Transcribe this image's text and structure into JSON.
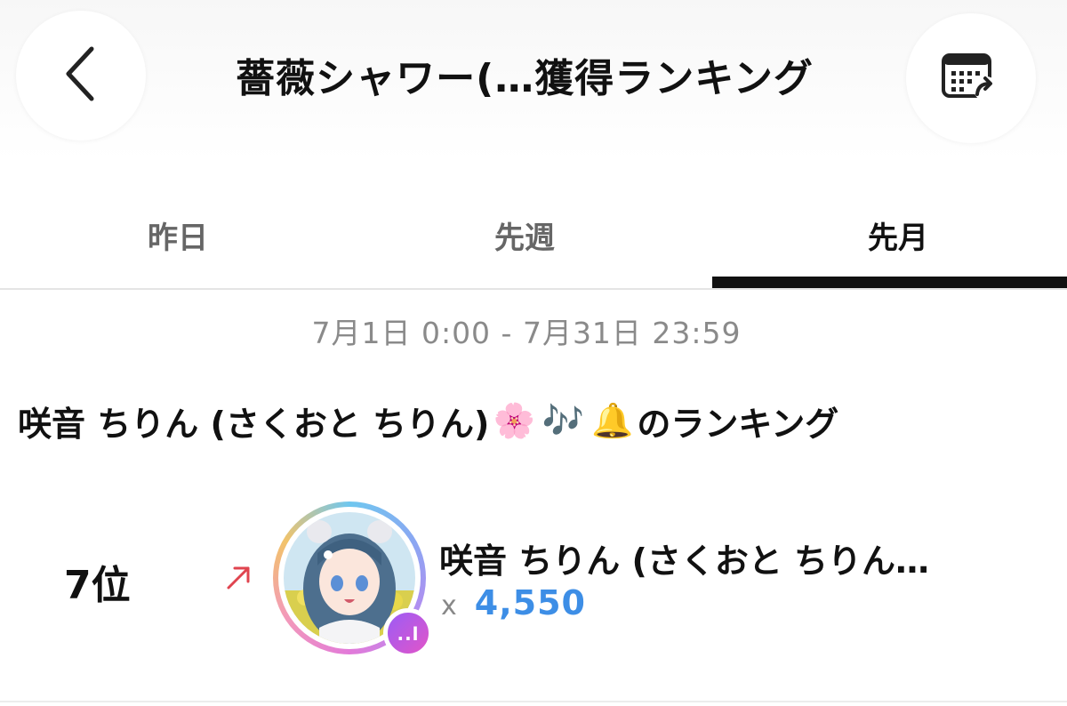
{
  "header": {
    "title": "薔薇シャワー(…獲得ランキング",
    "back_icon": "chevron-left-icon",
    "calendar_icon": "calendar-share-icon"
  },
  "tabs": [
    {
      "label": "昨日",
      "active": false
    },
    {
      "label": "先週",
      "active": false
    },
    {
      "label": "先月",
      "active": true
    }
  ],
  "period": "7月1日 0:00 - 7月31日 23:59",
  "section": {
    "name": "咲音 ちりん (さくおと ちりん)",
    "emoji_flower": "🌸",
    "emoji_notes": "🎶",
    "emoji_bell": "🔔",
    "suffix": "のランキング"
  },
  "entry": {
    "rank": "7位",
    "trend": "up",
    "trend_color": "#e0444f",
    "name": "咲音 ちりん (さくおと ちりん…",
    "multiplier": "x",
    "count": "4,550",
    "count_color": "#3d8ee6",
    "badge": "..l"
  }
}
